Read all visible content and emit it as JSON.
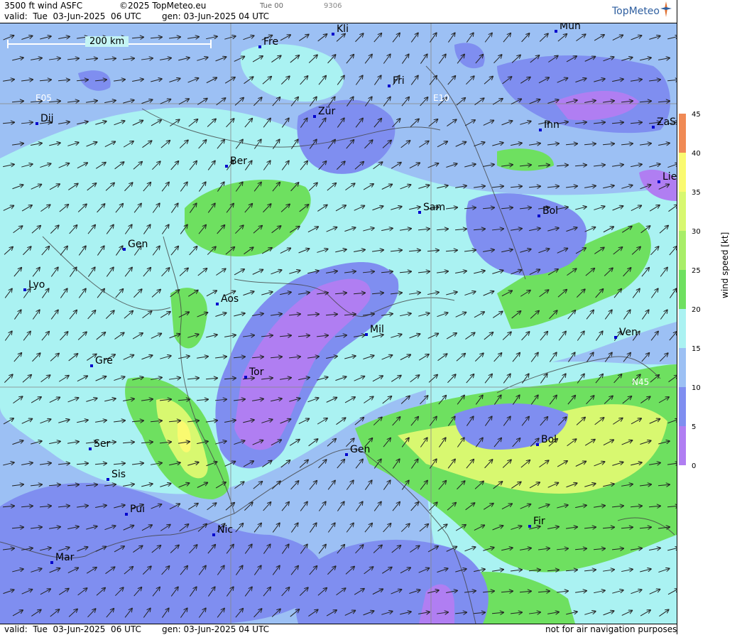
{
  "header": {
    "product": "3500 ft wind ASFC",
    "copyright": "©2025 TopMeteo.eu",
    "run_tag": "Tue 00",
    "code": "9306",
    "valid": "valid:  Tue  03-Jun-2025  06 UTC",
    "gen": "gen: 03-Jun-2025 04 UTC"
  },
  "logo": {
    "text": "TopMeteo"
  },
  "footer": {
    "valid": "valid:  Tue  03-Jun-2025  06 UTC",
    "gen": "gen: 03-Jun-2025 04 UTC",
    "disclaimer": "not for air navigation purposes"
  },
  "scale": {
    "label": "200 km"
  },
  "grid_labels": [
    "E05",
    "E10",
    "N45"
  ],
  "cities": [
    "Kli",
    "Mun",
    "Fre",
    "Fri",
    "Dij",
    "Zür",
    "E10",
    "Inn",
    "ZaS",
    "Ber",
    "Lie",
    "Sam",
    "Bol",
    "Gen",
    "Lyo",
    "Aos",
    "Mil",
    "Ven",
    "Gre",
    "Tor",
    "Ser",
    "Gen",
    "Bol",
    "Sis",
    "Pui",
    "Nic",
    "Fir",
    "Mar"
  ],
  "legend": {
    "title": "wind speed [kt]",
    "ticks": [
      "45",
      "40",
      "35",
      "30",
      "25",
      "20",
      "15",
      "10",
      "5",
      "0"
    ],
    "colors": [
      "#e85a4a",
      "#f08a55",
      "#f7c455",
      "#fafa70",
      "#d8f870",
      "#a8ee68",
      "#6ee060",
      "#aaf2f2",
      "#9cc0f4",
      "#7f8ef0",
      "#b07ef2"
    ]
  }
}
